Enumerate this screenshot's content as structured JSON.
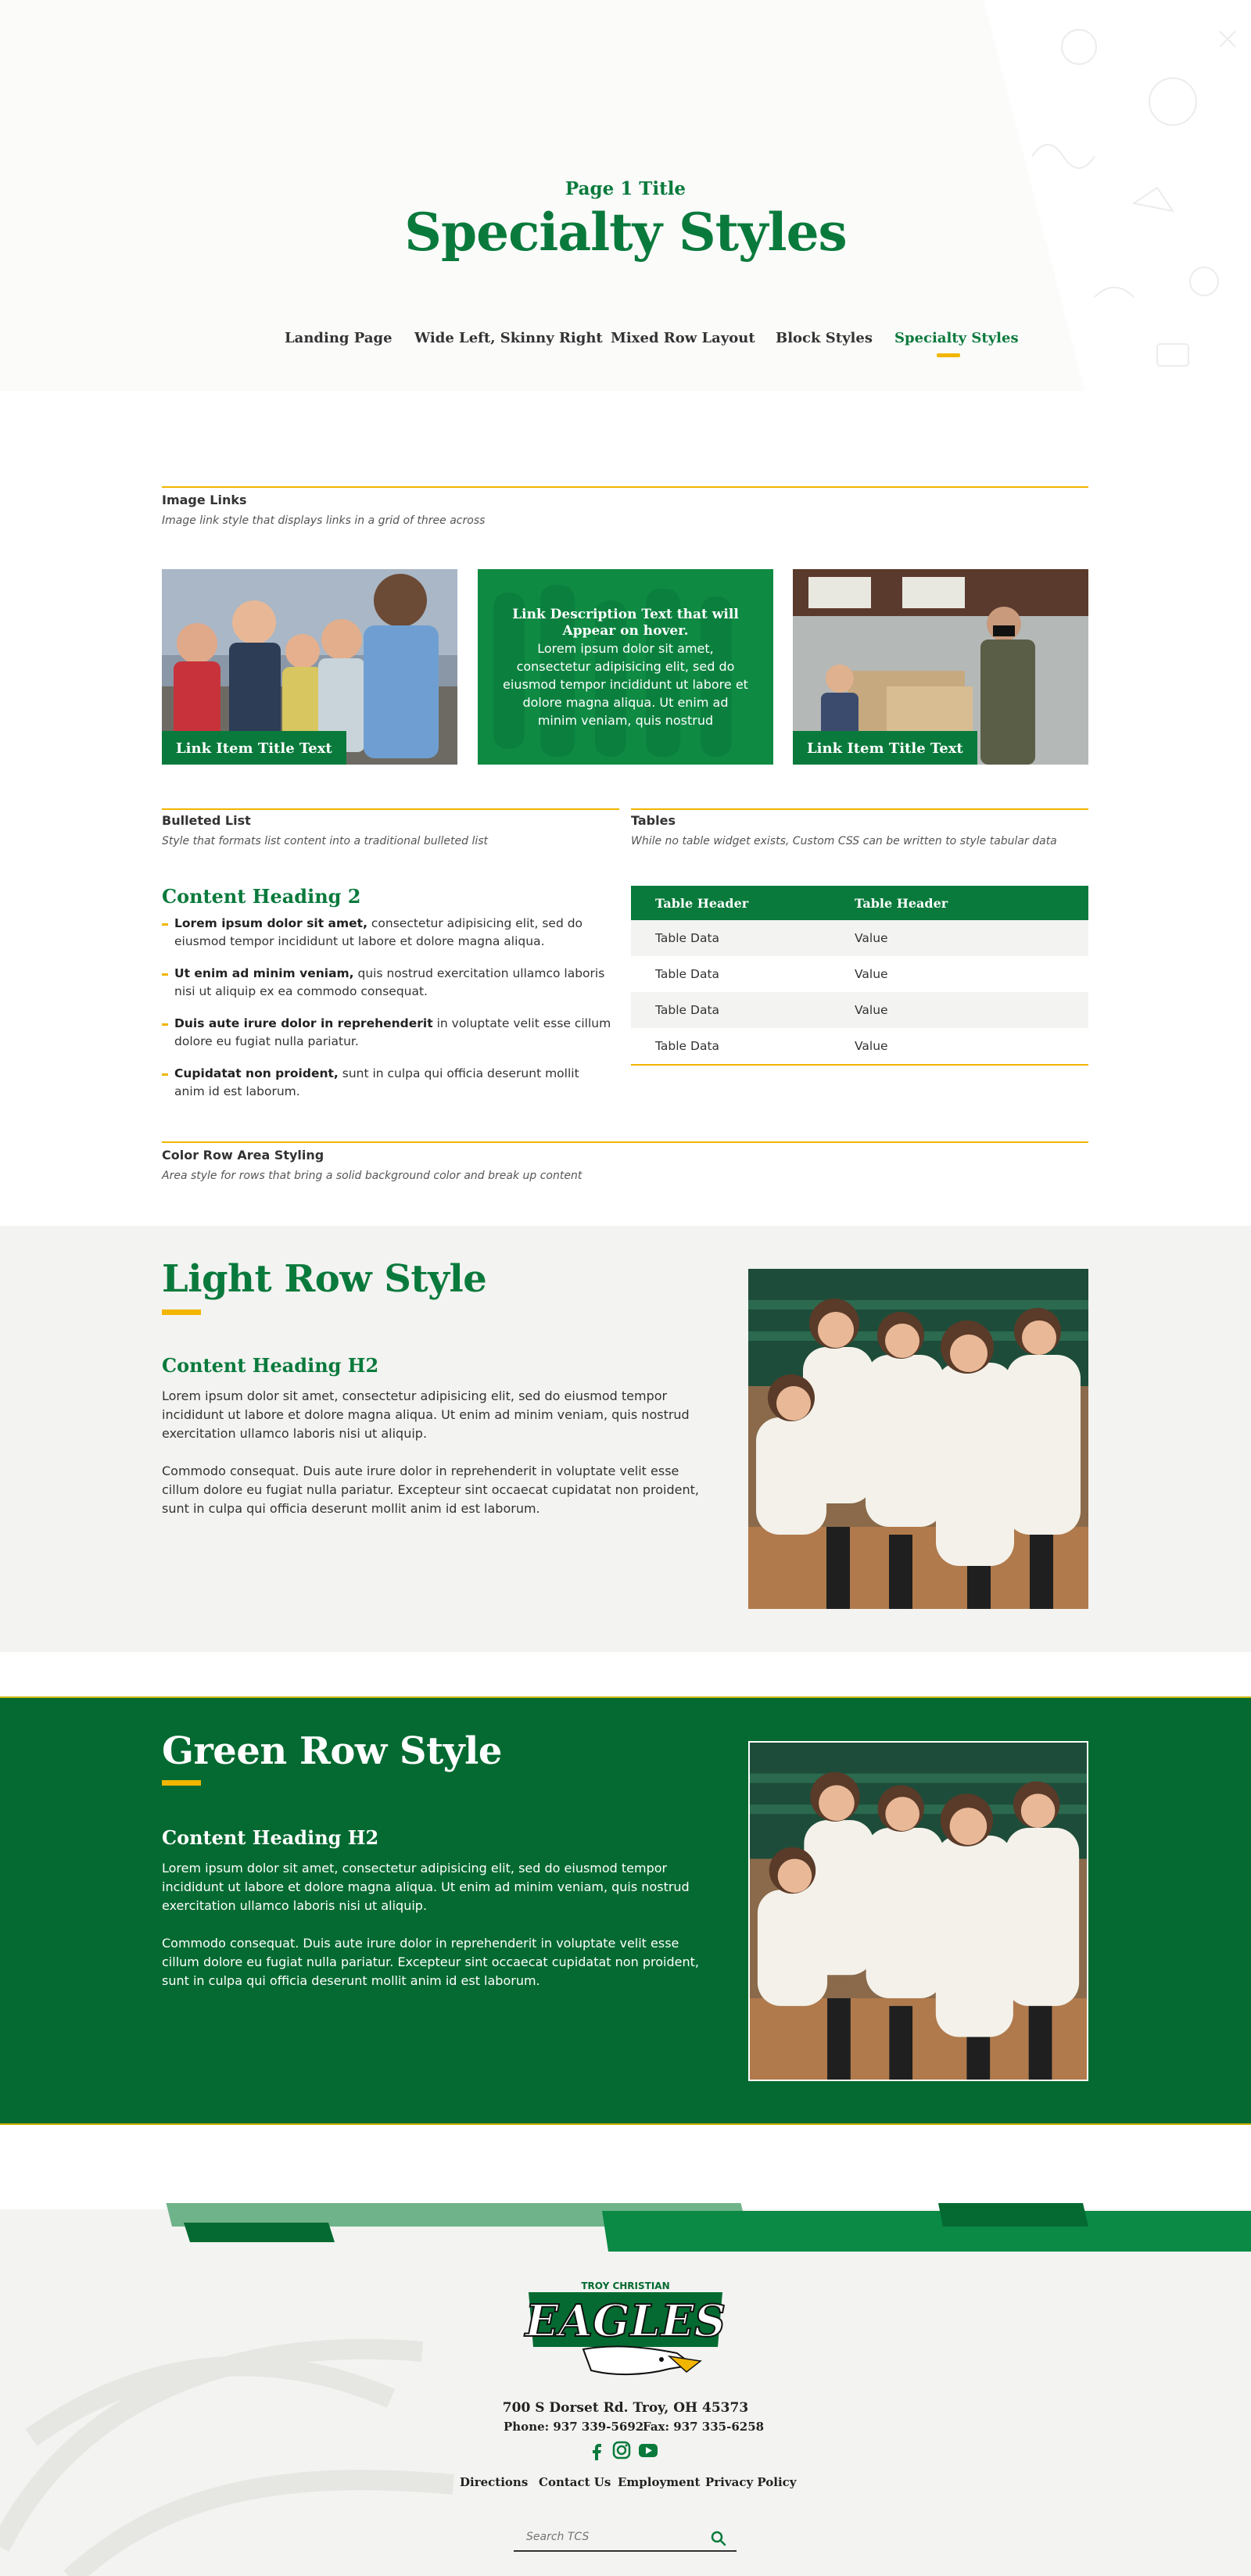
{
  "header": {
    "subtitle": "Page 1 Title",
    "title": "Specialty Styles",
    "nav": [
      {
        "label": "Landing Page",
        "active": false
      },
      {
        "label": "Wide Left, Skinny Right",
        "active": false
      },
      {
        "label": "Mixed Row Layout",
        "active": false
      },
      {
        "label": "Block Styles",
        "active": false
      },
      {
        "label": "Specialty Styles",
        "active": true
      }
    ]
  },
  "image_links": {
    "label": "Image Links",
    "description": "Image link style that displays links in a grid of three across",
    "tiles": [
      {
        "caption": "Link Item Title Text",
        "icon": "photo-kids"
      },
      {
        "hover_title": "Link Description Text that will Appear on hover.",
        "hover_text": "Lorem ipsum dolor sit amet, consectetur adipisicing elit, sed do eiusmod tempor incididunt ut labore et dolore magna aliqua. Ut enim ad minim veniam, quis nostrud"
      },
      {
        "caption": "Link Item Title Text",
        "icon": "photo-classroom"
      }
    ]
  },
  "bulleted": {
    "label": "Bulleted List",
    "description": "Style that formats list content into a traditional bulleted list",
    "heading": "Content Heading 2",
    "items": [
      {
        "bold": "Lorem ipsum dolor sit amet,",
        "text": " consectetur adipisicing elit, sed do eiusmod tempor incididunt ut labore et dolore magna aliqua."
      },
      {
        "bold": "Ut enim ad minim veniam,",
        "text": " quis nostrud exercitation ullamco laboris nisi ut aliquip ex ea commodo consequat."
      },
      {
        "bold": "Duis aute irure dolor in reprehenderit",
        "text": " in voluptate velit esse cillum dolore eu fugiat nulla pariatur."
      },
      {
        "bold": "Cupidatat non proident,",
        "text": " sunt in culpa qui officia deserunt mollit anim id est laborum."
      }
    ]
  },
  "tables": {
    "label": "Tables",
    "description": "While no table widget exists, Custom CSS can be written to style tabular data",
    "headers": [
      "Table Header",
      "Table Header"
    ],
    "rows": [
      [
        "Table Data",
        "Value"
      ],
      [
        "Table Data",
        "Value"
      ],
      [
        "Table Data",
        "Value"
      ],
      [
        "Table Data",
        "Value"
      ]
    ]
  },
  "color_rows": {
    "label": "Color Row Area Styling",
    "description": "Area style for rows that bring a solid background color and break up content"
  },
  "light_row": {
    "title": "Light Row Style",
    "heading": "Content Heading H2",
    "p1": "Lorem ipsum dolor sit amet, consectetur adipisicing elit, sed do eiusmod tempor incididunt ut labore et dolore magna aliqua. Ut enim ad minim veniam, quis nostrud exercitation ullamco laboris nisi ut aliquip.",
    "p2": "Commodo consequat. Duis aute irure dolor in reprehenderit in voluptate velit esse cillum dolore eu fugiat nulla pariatur. Excepteur sint occaecat cupidatat non proident, sunt in culpa qui officia deserunt mollit anim id est laborum."
  },
  "green_row": {
    "title": "Green Row Style",
    "heading": "Content Heading H2",
    "p1": "Lorem ipsum dolor sit amet, consectetur adipisicing elit, sed do eiusmod tempor incididunt ut labore et dolore magna aliqua. Ut enim ad minim veniam, quis nostrud exercitation ullamco laboris nisi ut aliquip.",
    "p2": "Commodo consequat. Duis aute irure dolor in reprehenderit in voluptate velit esse cillum dolore eu fugiat nulla pariatur. Excepteur sint occaecat cupidatat non proident, sunt in culpa qui officia deserunt mollit anim id est laborum."
  },
  "footer": {
    "logo_small": "TROY CHRISTIAN",
    "logo_big": "EAGLES",
    "address": "700 S Dorset Rd. Troy, OH 45373",
    "phone": "Phone: 937 339-5692",
    "fax": "Fax: 937 335-6258",
    "social": [
      "facebook-icon",
      "instagram-icon",
      "youtube-icon"
    ],
    "links": [
      "Directions",
      "Contact Us",
      "Employment",
      "Privacy Policy"
    ],
    "search_placeholder": "Search TCS"
  },
  "colors": {
    "brand_green": "#0a7a3c",
    "dark_green": "#046a31",
    "accent_gold": "#f2b600",
    "light_bg": "#f3f3f1"
  }
}
